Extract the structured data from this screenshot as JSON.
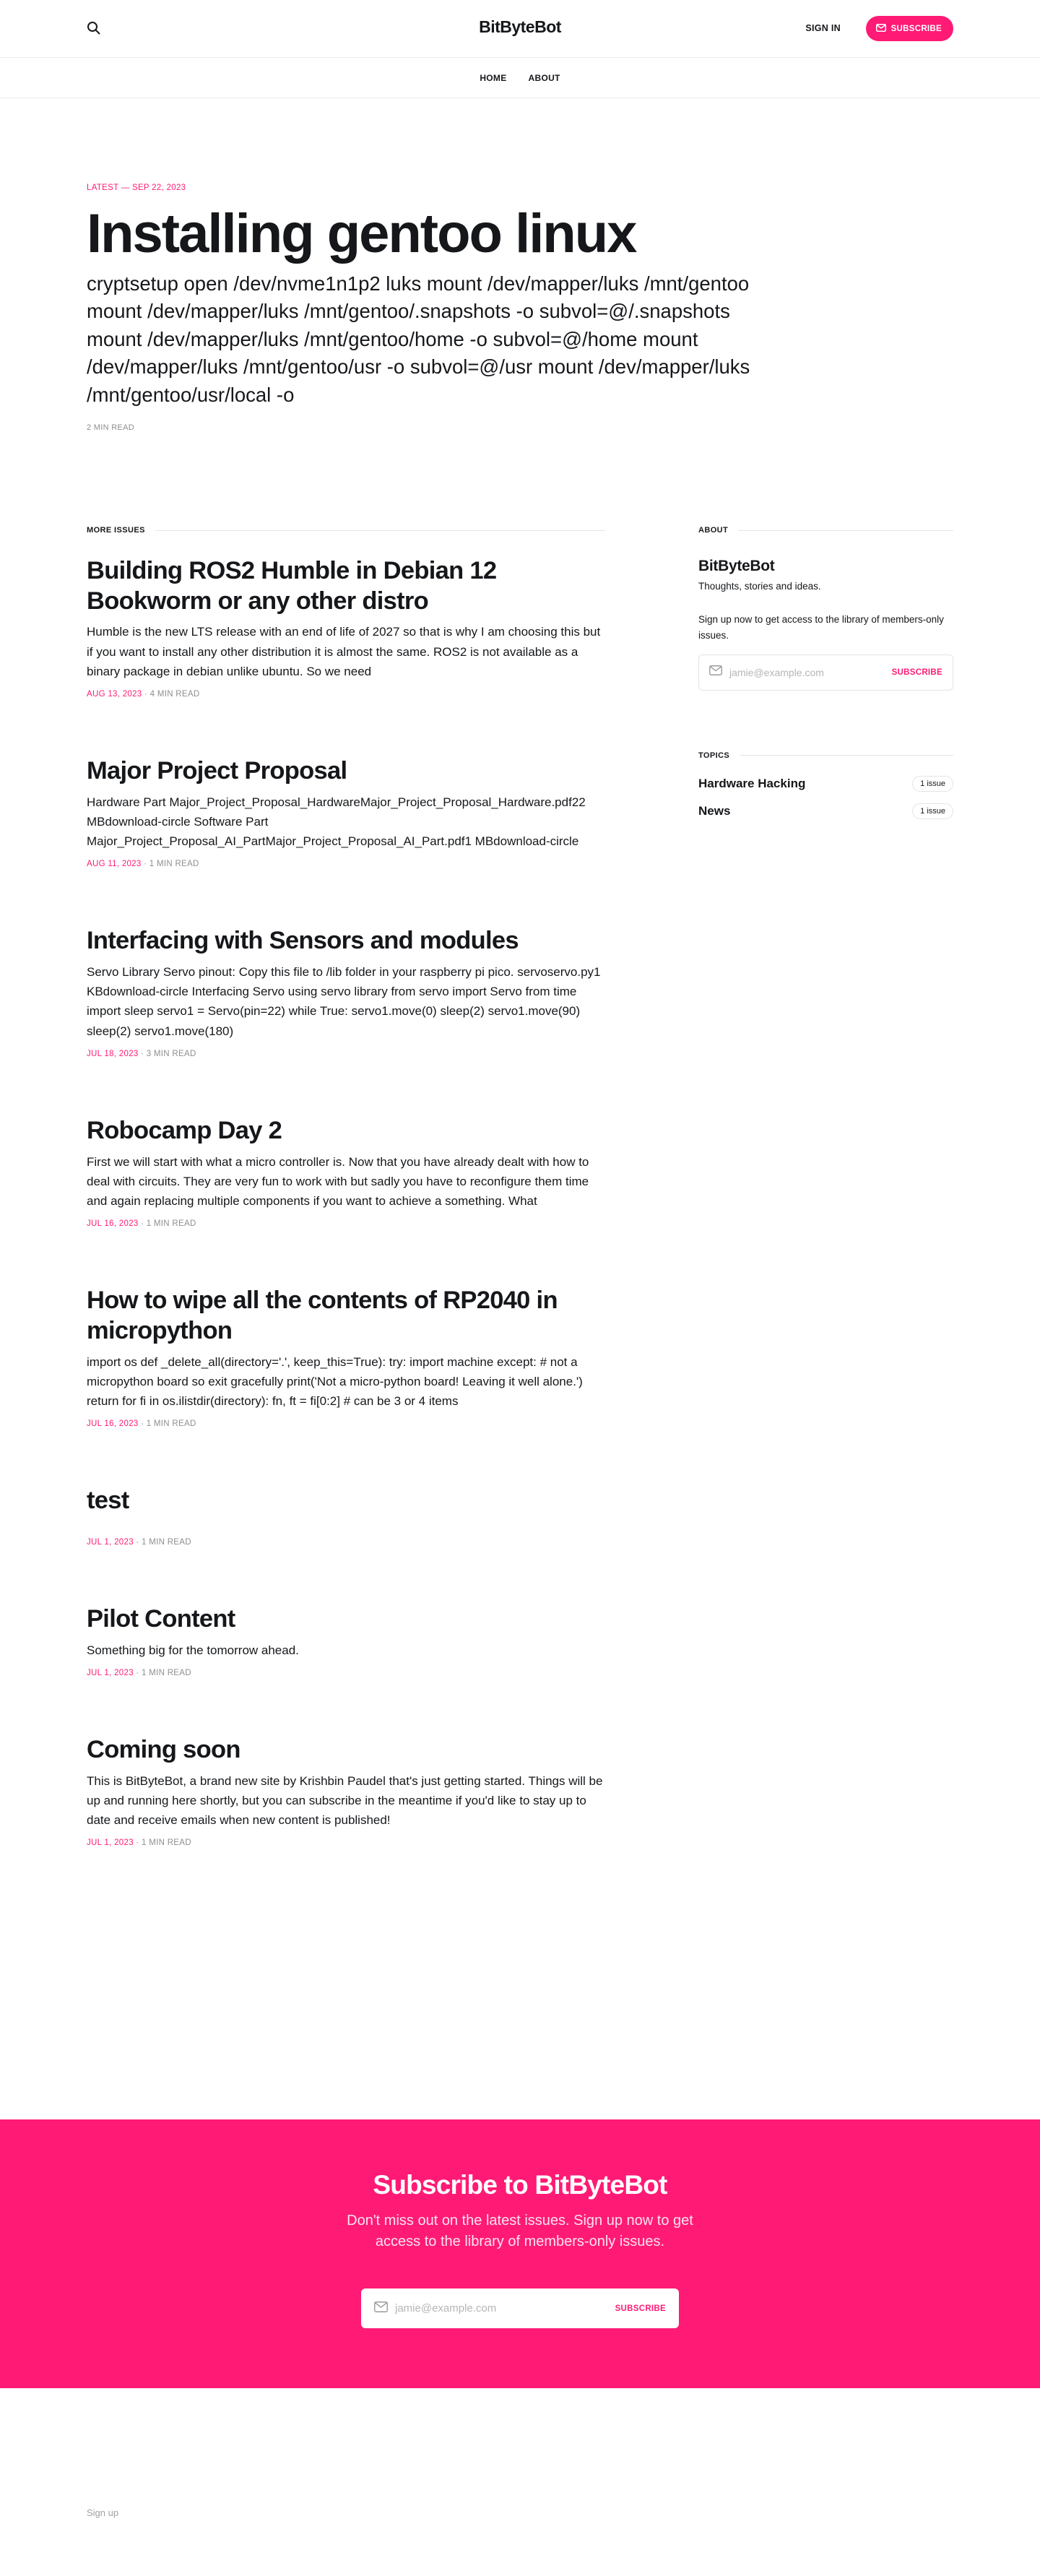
{
  "header": {
    "site_title": "BitByteBot",
    "signin_label": "SIGN IN",
    "subscribe_label": "SUBSCRIBE",
    "icons": {
      "search": "search-icon",
      "subscribe": "mail-icon"
    }
  },
  "nav": {
    "items": [
      {
        "label": "HOME"
      },
      {
        "label": "ABOUT"
      }
    ]
  },
  "hero": {
    "label": "LATEST — SEP 22, 2023",
    "title": "Installing gentoo linux",
    "excerpt": "cryptsetup open /dev/nvme1n1p2 luks mount /dev/mapper/luks /mnt/gentoo mount /dev/mapper/luks /mnt/gentoo/.snapshots -o subvol=@/.snapshots mount /dev/mapper/luks /mnt/gentoo/home -o subvol=@/home mount /dev/mapper/luks /mnt/gentoo/usr -o subvol=@/usr mount /dev/mapper/luks /mnt/gentoo/usr/local -o",
    "meta": "2 MIN READ"
  },
  "feed": {
    "heading": "MORE ISSUES",
    "separator": "·",
    "posts": [
      {
        "title": "Building ROS2 Humble in Debian 12 Bookworm or any other distro",
        "excerpt": "Humble is the new LTS release with an end of life of 2027 so that is why I am choosing this but if you want to install any other distribution it is almost the same. ROS2 is not available as a binary package in debian unlike ubuntu. So we need",
        "date": "AUG 13, 2023",
        "read": "4 MIN READ"
      },
      {
        "title": "Major Project Proposal",
        "excerpt": "Hardware Part Major_Project_Proposal_HardwareMajor_Project_Proposal_Hardware.pdf22 MBdownload-circle Software Part Major_Project_Proposal_AI_PartMajor_Project_Proposal_AI_Part.pdf1 MBdownload-circle",
        "date": "AUG 11, 2023",
        "read": "1 MIN READ"
      },
      {
        "title": "Interfacing with Sensors and modules",
        "excerpt": "Servo Library Servo pinout: Copy this file to /lib folder in your raspberry pi pico. servoservo.py1 KBdownload-circle Interfacing Servo using servo library from servo import Servo from time import sleep servo1 = Servo(pin=22) while True: servo1.move(0) sleep(2) servo1.move(90) sleep(2) servo1.move(180)",
        "date": "JUL 18, 2023",
        "read": "3 MIN READ"
      },
      {
        "title": "Robocamp Day 2",
        "excerpt": "First we will start with what a micro controller is. Now that you have already dealt with how to deal with circuits. They are very fun to work with but sadly you have to reconfigure them time and again replacing multiple components if you want to achieve a something. What",
        "date": "JUL 16, 2023",
        "read": "1 MIN READ"
      },
      {
        "title": "How to wipe all the contents of RP2040 in micropython",
        "excerpt": "import os def _delete_all(directory='.', keep_this=True): try: import machine except: # not a micropython board so exit gracefully print('Not a micro-python board! Leaving it well alone.') return for fi in os.ilistdir(directory): fn, ft = fi[0:2] # can be 3 or 4 items",
        "date": "JUL 16, 2023",
        "read": "1 MIN READ"
      },
      {
        "title": "test",
        "excerpt": "",
        "date": "JUL 1, 2023",
        "read": "1 MIN READ"
      },
      {
        "title": "Pilot Content",
        "excerpt": "Something big for the tomorrow ahead.",
        "date": "JUL 1, 2023",
        "read": "1 MIN READ"
      },
      {
        "title": "Coming soon",
        "excerpt": "This is BitByteBot, a brand new site by Krishbin Paudel that's just getting started. Things will be up and running here shortly, but you can subscribe in the meantime if you'd like to stay up to date and receive emails when new content is published!",
        "date": "JUL 1, 2023",
        "read": "1 MIN READ"
      }
    ]
  },
  "sidebar": {
    "about_heading": "ABOUT",
    "title": "BitByteBot",
    "description": "Thoughts, stories and ideas.",
    "cta": "Sign up now to get access to the library of members-only issues.",
    "email_placeholder": "jamie@example.com",
    "subscribe_label": "SUBSCRIBE",
    "topics_heading": "TOPICS",
    "topics": [
      {
        "name": "Hardware Hacking",
        "count": "1 issue"
      },
      {
        "name": "News",
        "count": "1 issue"
      }
    ]
  },
  "subscribe_band": {
    "title": "Subscribe to BitByteBot",
    "description": "Don't miss out on the latest issues. Sign up now to get access to the library of members-only issues.",
    "email_placeholder": "jamie@example.com",
    "button_label": "SUBSCRIBE"
  },
  "footer": {
    "signup_link": "Sign up"
  },
  "colors": {
    "accent": "#ff1a75",
    "text": "#15171a",
    "muted": "#8e8e8e",
    "border": "#ececec"
  }
}
